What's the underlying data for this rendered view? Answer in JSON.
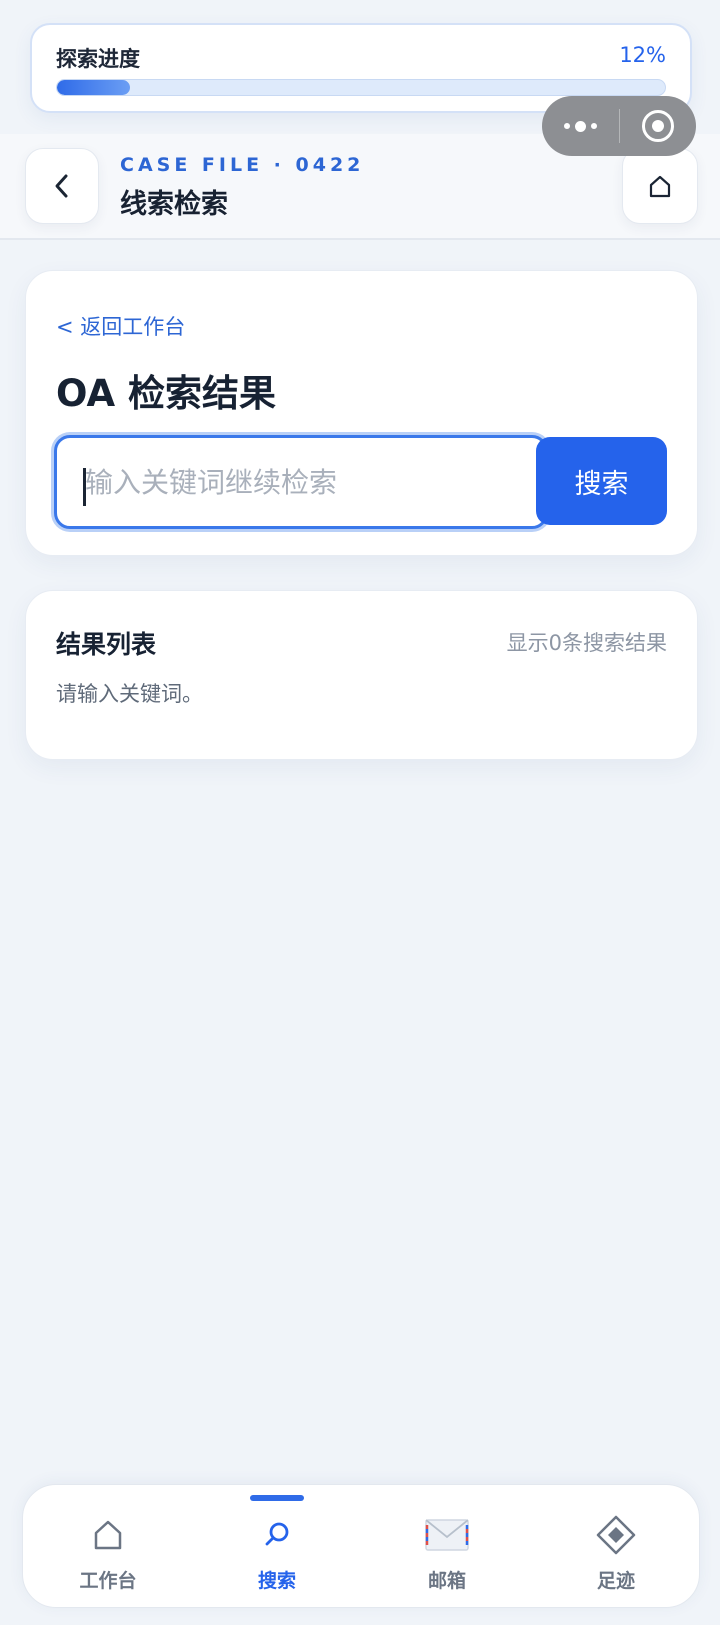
{
  "progress": {
    "title": "探索进度",
    "percent_label": "12%",
    "fraction": 0.12
  },
  "capsule": {
    "more_icon": "more-dots-icon",
    "close_icon": "target-close-icon"
  },
  "header": {
    "case_label": "CASE FILE · 0422",
    "title": "线索检索",
    "back_icon": "chevron-left-icon",
    "home_icon": "home-icon"
  },
  "search": {
    "back_link": "< 返回工作台",
    "title": "OA 检索结果",
    "input_value": "",
    "placeholder": "输入关键词继续检索",
    "button_label": "搜索"
  },
  "results": {
    "title": "结果列表",
    "count_text": "显示0条搜索结果",
    "empty_text": "请输入关键词。"
  },
  "tabbar": {
    "active_index": 1,
    "items": [
      {
        "label": "工作台",
        "icon": "home-icon"
      },
      {
        "label": "搜索",
        "icon": "search-icon"
      },
      {
        "label": "邮箱",
        "icon": "envelope-icon"
      },
      {
        "label": "足迹",
        "icon": "diamond-icon"
      }
    ]
  },
  "colors": {
    "accent": "#2563eb",
    "background": "#f0f4f9",
    "text_primary": "#172233",
    "text_muted": "#8d96a4"
  }
}
